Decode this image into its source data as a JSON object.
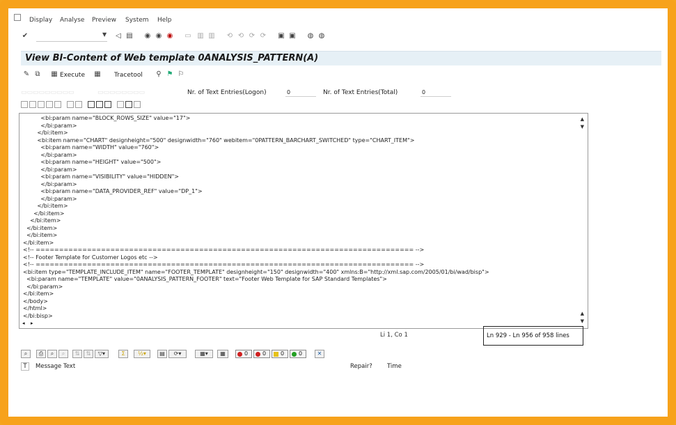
{
  "menu": {
    "items": [
      "Display",
      "Analyse",
      "Preview",
      "System",
      "Help"
    ]
  },
  "title": "View BI-Content of Web template 0ANALYSIS_PATTERN(A)",
  "app_toolbar": {
    "execute_label": "Execute",
    "tracetool_label": "Tracetool"
  },
  "info": {
    "logon_label": "Nr. of Text Entries(Logon)",
    "logon_value": "0",
    "total_label": "Nr. of Text Entries(Total)",
    "total_value": "0"
  },
  "editor": {
    "lines": [
      "          <bi:param name=\"BLOCK_ROWS_SIZE\" value=\"17\">",
      "          </bi:param>",
      "        </bi:item>",
      "        <bi:item name=\"CHART\" designheight=\"500\" designwidth=\"760\" webitem=\"0PATTERN_BARCHART_SWITCHED\" type=\"CHART_ITEM\">",
      "          <bi:param name=\"WIDTH\" value=\"760\">",
      "          </bi:param>",
      "          <bi:param name=\"HEIGHT\" value=\"500\">",
      "          </bi:param>",
      "          <bi:param name=\"VISIBILITY\" value=\"HIDDEN\">",
      "          </bi:param>",
      "          <bi:param name=\"DATA_PROVIDER_REF\" value=\"DP_1\">",
      "          </bi:param>",
      "        </bi:item>",
      "      </bi:item>",
      "    </bi:item>",
      "  </bi:item>",
      "  </bi:item>",
      "</bi:item>",
      "<!-- ================================================================================= -->",
      "<!-- Footer Template for Customer Logos etc -->",
      "<!-- ================================================================================= -->",
      "<bi:item type=\"TEMPLATE_INCLUDE_ITEM\" name=\"FOOTER_TEMPLATE\" designheight=\"150\" designwidth=\"400\" xmlns:B=\"http://xml.sap.com/2005/01/bi/wad/bisp\">",
      "  <bi:param name=\"TEMPLATE\" value=\"0ANALYSIS_PATTERN_FOOTER\" text=\"Footer Web Template for SAP Standard Templates\">",
      "  </bi:param>",
      "</bi:item>",
      "</body>",
      "</html>",
      "</bi:bisp>"
    ]
  },
  "status": {
    "position": "Li 1, Co 1",
    "lines": "Ln 929 - Ln 956 of 958 lines"
  },
  "messages": {
    "lights": [
      {
        "count": "0",
        "color": "#d02020"
      },
      {
        "count": "0",
        "color": "#d02020"
      },
      {
        "count": "0",
        "color": "#e6c21a"
      },
      {
        "count": "0",
        "color": "#23a023"
      }
    ],
    "header": {
      "type": "T",
      "message_text": "Message Text",
      "repair": "Repair?",
      "time": "Time"
    }
  }
}
